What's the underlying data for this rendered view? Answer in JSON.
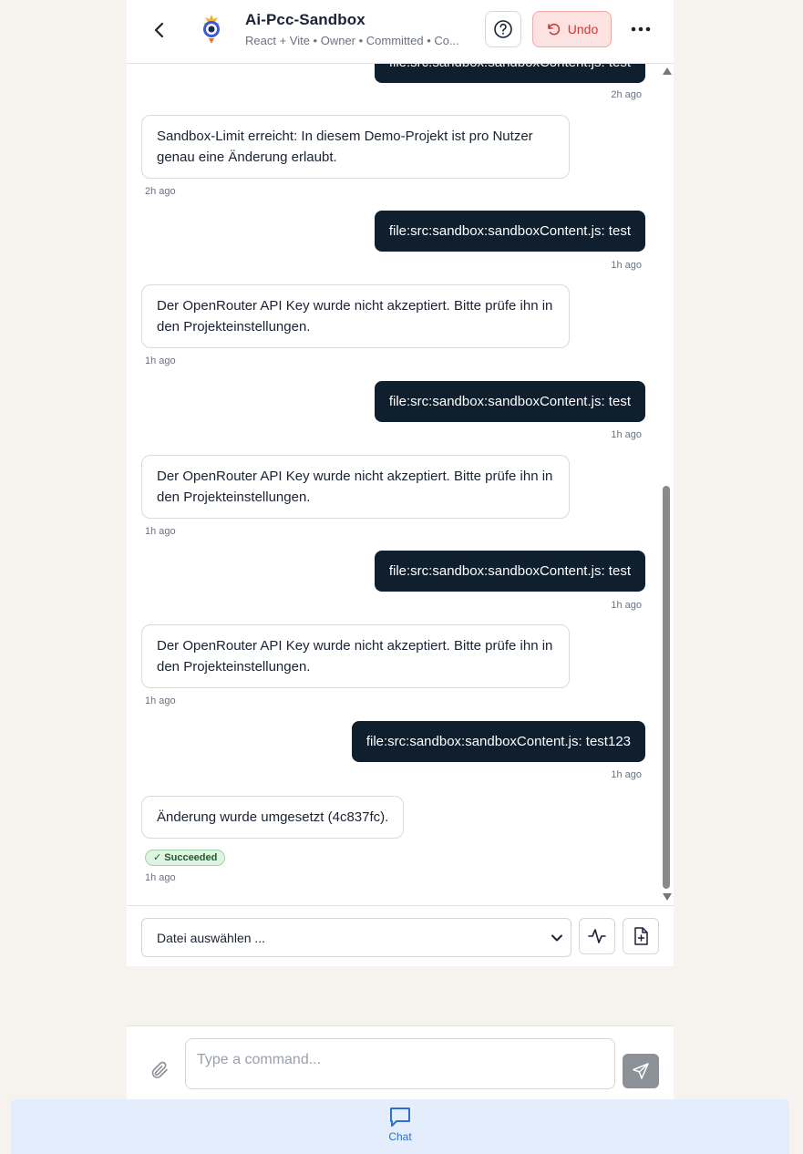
{
  "header": {
    "title": "Ai-Pcc-Sandbox",
    "subtitle": "React + Vite • Owner • Committed • Co...",
    "undo_label": "Undo"
  },
  "messages": [
    {
      "role": "user",
      "text": "file:src:sandbox:sandboxContent.js: test",
      "time": "2h ago"
    },
    {
      "role": "bot",
      "text": "Sandbox-Limit erreicht: In diesem Demo-Projekt ist pro Nutzer genau eine Änderung erlaubt.",
      "time": "2h ago"
    },
    {
      "role": "user",
      "text": "file:src:sandbox:sandboxContent.js: test",
      "time": "1h ago"
    },
    {
      "role": "bot",
      "text": "Der OpenRouter API Key wurde nicht akzeptiert. Bitte prüfe ihn in den Projekteinstellungen.",
      "time": "1h ago"
    },
    {
      "role": "user",
      "text": "file:src:sandbox:sandboxContent.js: test",
      "time": "1h ago"
    },
    {
      "role": "bot",
      "text": "Der OpenRouter API Key wurde nicht akzeptiert. Bitte prüfe ihn in den Projekteinstellungen.",
      "time": "1h ago"
    },
    {
      "role": "user",
      "text": "file:src:sandbox:sandboxContent.js: test",
      "time": "1h ago"
    },
    {
      "role": "bot",
      "text": "Der OpenRouter API Key wurde nicht akzeptiert. Bitte prüfe ihn in den Projekteinstellungen.",
      "time": "1h ago"
    },
    {
      "role": "user",
      "text": "file:src:sandbox:sandboxContent.js: test123",
      "time": "1h ago"
    },
    {
      "role": "bot",
      "text": "Änderung wurde umgesetzt (4c837fc).",
      "time": "1h ago",
      "badge": "✓ Succeeded"
    }
  ],
  "file_bar": {
    "select_value": "Datei auswählen ..."
  },
  "composer": {
    "placeholder": "Type a command..."
  },
  "nav": {
    "chat_label": "Chat"
  },
  "colors": {
    "user_bubble": "#0f1f2e",
    "undo_bg": "#fde2e2",
    "undo_text": "#c83a3a",
    "success_badge": "#dff3e2",
    "nav_accent": "#2f6fd0"
  }
}
